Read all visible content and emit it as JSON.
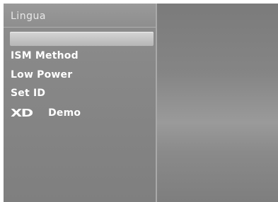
{
  "menu": {
    "title": "Lingua",
    "selected_item": "",
    "items": [
      {
        "label": "ISM Method"
      },
      {
        "label": "Low Power"
      },
      {
        "label": "Set ID"
      },
      {
        "logo": "XD",
        "label": "Demo"
      }
    ]
  },
  "colors": {
    "panel": "#8a8a8a",
    "highlight": "#c9c9c9",
    "text": "#ffffff",
    "title_text": "#e8e8e8"
  }
}
